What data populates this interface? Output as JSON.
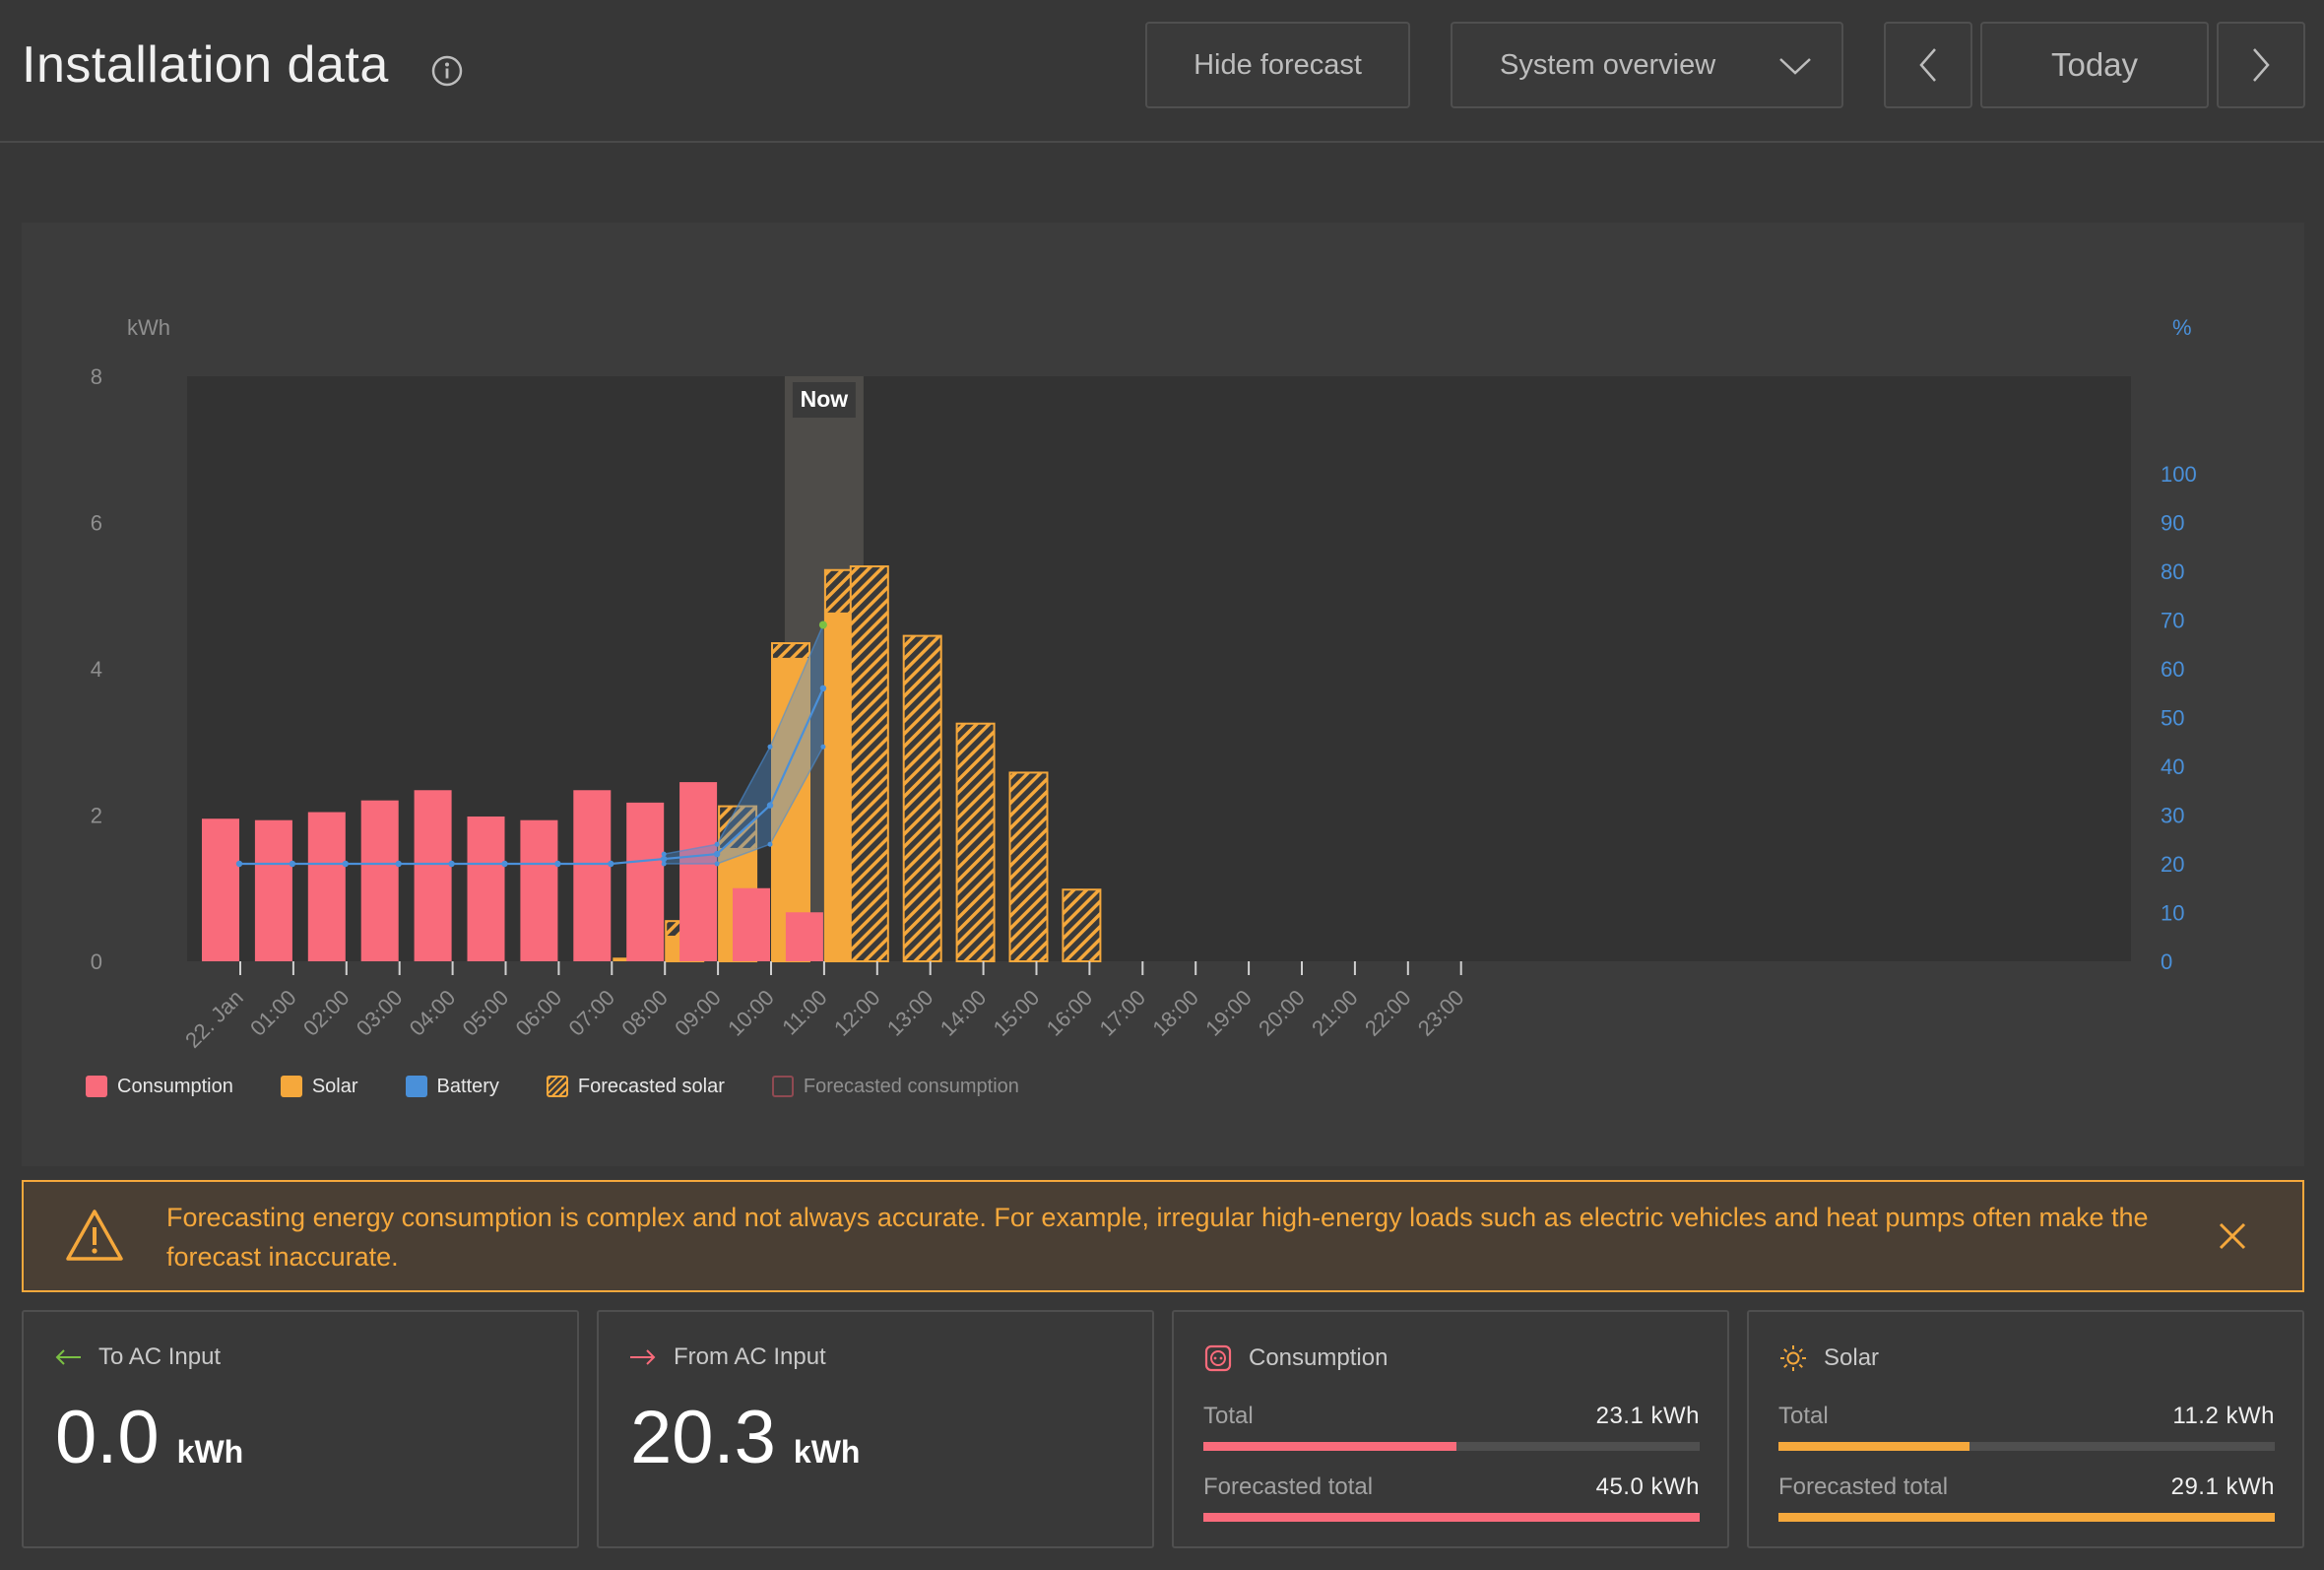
{
  "header": {
    "title": "Installation data",
    "hide_forecast": "Hide forecast",
    "view_select": "System overview",
    "today": "Today"
  },
  "chart": {
    "y_left_unit": "kWh",
    "y_right_unit": "%",
    "now_label": "Now"
  },
  "chart_data": {
    "type": "bar",
    "categories": [
      "22. Jan",
      "01:00",
      "02:00",
      "03:00",
      "04:00",
      "05:00",
      "06:00",
      "07:00",
      "08:00",
      "09:00",
      "10:00",
      "11:00",
      "12:00",
      "13:00",
      "14:00",
      "15:00",
      "16:00",
      "17:00",
      "18:00",
      "19:00",
      "20:00",
      "21:00",
      "22:00",
      "23:00"
    ],
    "ylim": [
      0,
      8
    ],
    "y_ticks": [
      0,
      2,
      4,
      6,
      8
    ],
    "y2lim": [
      0,
      100
    ],
    "y2_ticks": [
      0,
      10,
      20,
      30,
      40,
      50,
      60,
      70,
      80,
      90,
      100
    ],
    "now_index": 11,
    "series": [
      {
        "name": "Consumption",
        "values": [
          1.95,
          1.93,
          2.04,
          2.2,
          2.34,
          1.98,
          1.93,
          2.34,
          2.17,
          2.45,
          1.0,
          0.67,
          0,
          0,
          0,
          0,
          0,
          0,
          0,
          0,
          0,
          0,
          0,
          0
        ]
      },
      {
        "name": "Solar",
        "values": [
          0,
          0,
          0,
          0,
          0,
          0,
          0,
          0.05,
          0.35,
          1.55,
          4.15,
          4.77,
          0,
          0,
          0,
          0,
          0,
          0,
          0,
          0,
          0,
          0,
          0,
          0
        ]
      },
      {
        "name": "Forecasted solar",
        "values": [
          0,
          0,
          0,
          0,
          0,
          0,
          0,
          0,
          0.55,
          2.12,
          4.35,
          5.35,
          5.4,
          4.45,
          3.25,
          2.58,
          0.98,
          0,
          0,
          0,
          0,
          0,
          0,
          0
        ]
      },
      {
        "name": "Battery",
        "axis": "right",
        "values": [
          20,
          20,
          20,
          20,
          20,
          20,
          20,
          20,
          21,
          22,
          32,
          56
        ]
      },
      {
        "name": "Battery upper",
        "axis": "right",
        "values": [
          null,
          null,
          null,
          null,
          null,
          null,
          null,
          null,
          22,
          24,
          44,
          69
        ]
      },
      {
        "name": "Battery lower",
        "axis": "right",
        "values": [
          null,
          null,
          null,
          null,
          null,
          null,
          null,
          null,
          20,
          20,
          24,
          44
        ]
      }
    ],
    "legend": [
      "Consumption",
      "Solar",
      "Battery",
      "Forecasted solar",
      "Forecasted consumption"
    ]
  },
  "legend": {
    "consumption": "Consumption",
    "solar": "Solar",
    "battery": "Battery",
    "forecasted_solar": "Forecasted solar",
    "forecasted_consumption": "Forecasted consumption"
  },
  "colors": {
    "consumption": "#f96b7b",
    "solar": "#f5a83c",
    "battery": "#4a90d9",
    "warning": "#f5a83c"
  },
  "warning": {
    "text": "Forecasting energy consumption is complex and not always accurate. For example, irregular high-energy loads such as electric vehicles and heat pumps often make the forecast inaccurate."
  },
  "cards": {
    "to_ac": {
      "title": "To AC Input",
      "value": "0.0",
      "unit": "kWh"
    },
    "from_ac": {
      "title": "From AC Input",
      "value": "20.3",
      "unit": "kWh"
    },
    "consumption": {
      "title": "Consumption",
      "total_label": "Total",
      "total_value": "23.1 kWh",
      "total_fraction": 0.51,
      "forecast_label": "Forecasted total",
      "forecast_value": "45.0 kWh",
      "forecast_fraction": 1.0
    },
    "solar": {
      "title": "Solar",
      "total_label": "Total",
      "total_value": "11.2 kWh",
      "total_fraction": 0.385,
      "forecast_label": "Forecasted total",
      "forecast_value": "29.1 kWh",
      "forecast_fraction": 1.0
    }
  }
}
